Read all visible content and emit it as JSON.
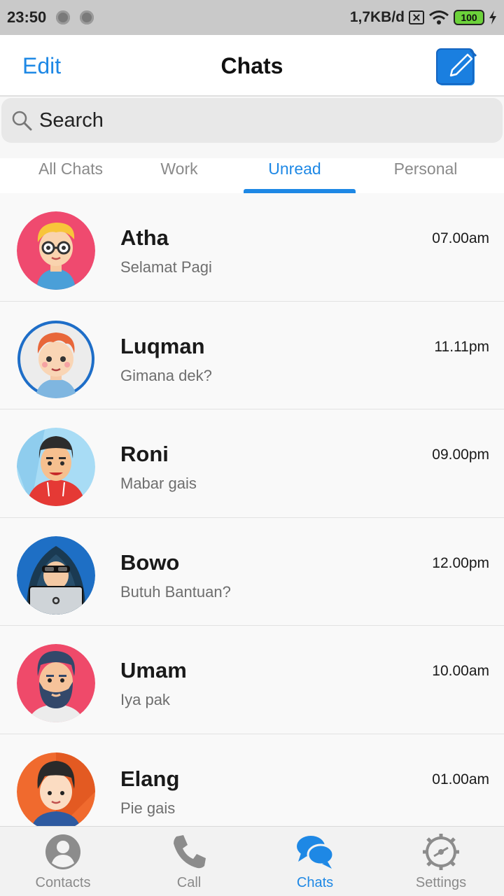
{
  "status_bar": {
    "time": "23:50",
    "speed": "1,7KB/d",
    "battery": "100"
  },
  "header": {
    "edit_label": "Edit",
    "title": "Chats",
    "compose_icon": "compose-icon"
  },
  "search": {
    "placeholder": "Search"
  },
  "tabs": [
    {
      "label": "All Chats",
      "active": false
    },
    {
      "label": "Work",
      "active": false
    },
    {
      "label": "Unread",
      "active": true
    },
    {
      "label": "Personal",
      "active": false
    }
  ],
  "chats": [
    {
      "name": "Atha",
      "message": "Selamat Pagi",
      "time": "07.00am"
    },
    {
      "name": "Luqman",
      "message": "Gimana dek?",
      "time": "11.11pm"
    },
    {
      "name": "Roni",
      "message": "Mabar gais",
      "time": "09.00pm"
    },
    {
      "name": "Bowo",
      "message": "Butuh Bantuan?",
      "time": "12.00pm"
    },
    {
      "name": "Umam",
      "message": "Iya pak",
      "time": "10.00am"
    },
    {
      "name": "Elang",
      "message": "Pie gais",
      "time": "01.00am"
    }
  ],
  "bottom_nav": [
    {
      "label": "Contacts",
      "icon": "contacts-icon",
      "active": false
    },
    {
      "label": "Call",
      "icon": "phone-icon",
      "active": false
    },
    {
      "label": "Chats",
      "icon": "chat-bubbles-icon",
      "active": true
    },
    {
      "label": "Settings",
      "icon": "gear-icon",
      "active": false
    }
  ],
  "colors": {
    "accent": "#1e88e5",
    "status_bar": "#c9c9c9",
    "battery": "#6cd23a"
  }
}
